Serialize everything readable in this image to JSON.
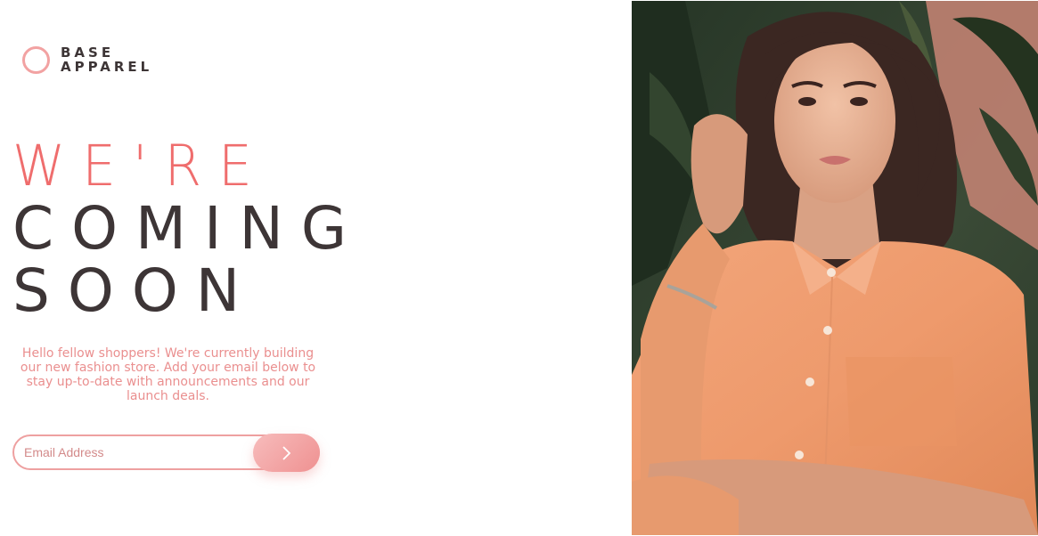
{
  "brand": {
    "line1": "BASE",
    "line2": "APPAREL",
    "ring_color": "#f2a2a2"
  },
  "headline": {
    "line1": "WE'RE",
    "line2": "COMING",
    "line3": "SOON",
    "accent_color": "#ef6d6d",
    "dark_color": "#3d3536"
  },
  "description": "Hello fellow shoppers! We're currently building our new fashion store. Add your email below to stay up-to-date with announcements and our launch deals.",
  "form": {
    "email_placeholder": "Email Address",
    "submit_icon": "chevron-right-icon"
  },
  "hero": {
    "icon": "hero-photo-woman-orange-shirt"
  }
}
